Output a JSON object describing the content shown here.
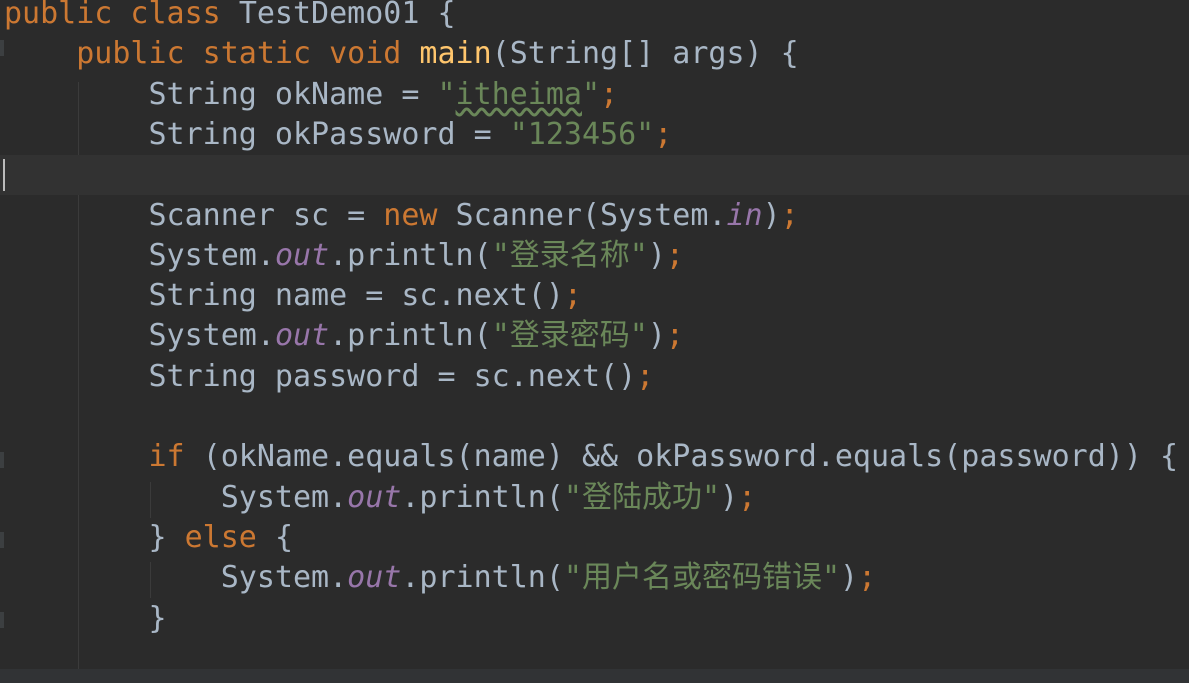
{
  "editor": {
    "lines": [
      [
        {
          "t": "public class ",
          "c": "kw"
        },
        {
          "t": "TestDemo01 ",
          "c": ""
        },
        {
          "t": "{",
          "c": ""
        }
      ],
      [
        {
          "t": "    ",
          "c": ""
        },
        {
          "t": "public static void ",
          "c": "kw"
        },
        {
          "t": "main",
          "c": "fn"
        },
        {
          "t": "(String[] args) {",
          "c": ""
        }
      ],
      [
        {
          "t": "        String okName = ",
          "c": ""
        },
        {
          "t": "\"",
          "c": "str"
        },
        {
          "t": "itheima",
          "c": "str typo"
        },
        {
          "t": "\"",
          "c": "str"
        },
        {
          "t": ";",
          "c": "punc"
        }
      ],
      [
        {
          "t": "        String okPassword = ",
          "c": ""
        },
        {
          "t": "\"123456\"",
          "c": "str"
        },
        {
          "t": ";",
          "c": "punc"
        }
      ],
      [],
      [
        {
          "t": "        Scanner sc = ",
          "c": ""
        },
        {
          "t": "new ",
          "c": "kw"
        },
        {
          "t": "Scanner(System.",
          "c": ""
        },
        {
          "t": "in",
          "c": "field"
        },
        {
          "t": ")",
          "c": ""
        },
        {
          "t": ";",
          "c": "punc"
        }
      ],
      [
        {
          "t": "        System.",
          "c": ""
        },
        {
          "t": "out",
          "c": "field"
        },
        {
          "t": ".println(",
          "c": ""
        },
        {
          "t": "\"登录名称\"",
          "c": "str"
        },
        {
          "t": ")",
          "c": ""
        },
        {
          "t": ";",
          "c": "punc"
        }
      ],
      [
        {
          "t": "        String name = sc.next()",
          "c": ""
        },
        {
          "t": ";",
          "c": "punc"
        }
      ],
      [
        {
          "t": "        System.",
          "c": ""
        },
        {
          "t": "out",
          "c": "field"
        },
        {
          "t": ".println(",
          "c": ""
        },
        {
          "t": "\"登录密码\"",
          "c": "str"
        },
        {
          "t": ")",
          "c": ""
        },
        {
          "t": ";",
          "c": "punc"
        }
      ],
      [
        {
          "t": "        String password = sc.next()",
          "c": ""
        },
        {
          "t": ";",
          "c": "punc"
        }
      ],
      [],
      [
        {
          "t": "        ",
          "c": ""
        },
        {
          "t": "if ",
          "c": "kw"
        },
        {
          "t": "(okName.equals(name) && okPassword.equals(password)) {",
          "c": ""
        }
      ],
      [
        {
          "t": "            System.",
          "c": ""
        },
        {
          "t": "out",
          "c": "field"
        },
        {
          "t": ".println(",
          "c": ""
        },
        {
          "t": "\"登陆成功\"",
          "c": "str"
        },
        {
          "t": ")",
          "c": ""
        },
        {
          "t": ";",
          "c": "punc"
        }
      ],
      [
        {
          "t": "        } ",
          "c": ""
        },
        {
          "t": "else ",
          "c": "kw"
        },
        {
          "t": "{",
          "c": ""
        }
      ],
      [
        {
          "t": "            System.",
          "c": ""
        },
        {
          "t": "out",
          "c": "field"
        },
        {
          "t": ".println(",
          "c": ""
        },
        {
          "t": "\"用户名或密码错误\"",
          "c": "str"
        },
        {
          "t": ")",
          "c": ""
        },
        {
          "t": ";",
          "c": "punc"
        }
      ],
      [
        {
          "t": "        }",
          "c": ""
        }
      ]
    ],
    "current_line_index": 4,
    "colors": {
      "background": "#2b2b2b",
      "default_text": "#a9b7c6",
      "keyword": "#cc7832",
      "method_declaration": "#ffc66d",
      "string": "#6a8759",
      "static_field": "#9876aa",
      "current_line": "#323232"
    }
  }
}
